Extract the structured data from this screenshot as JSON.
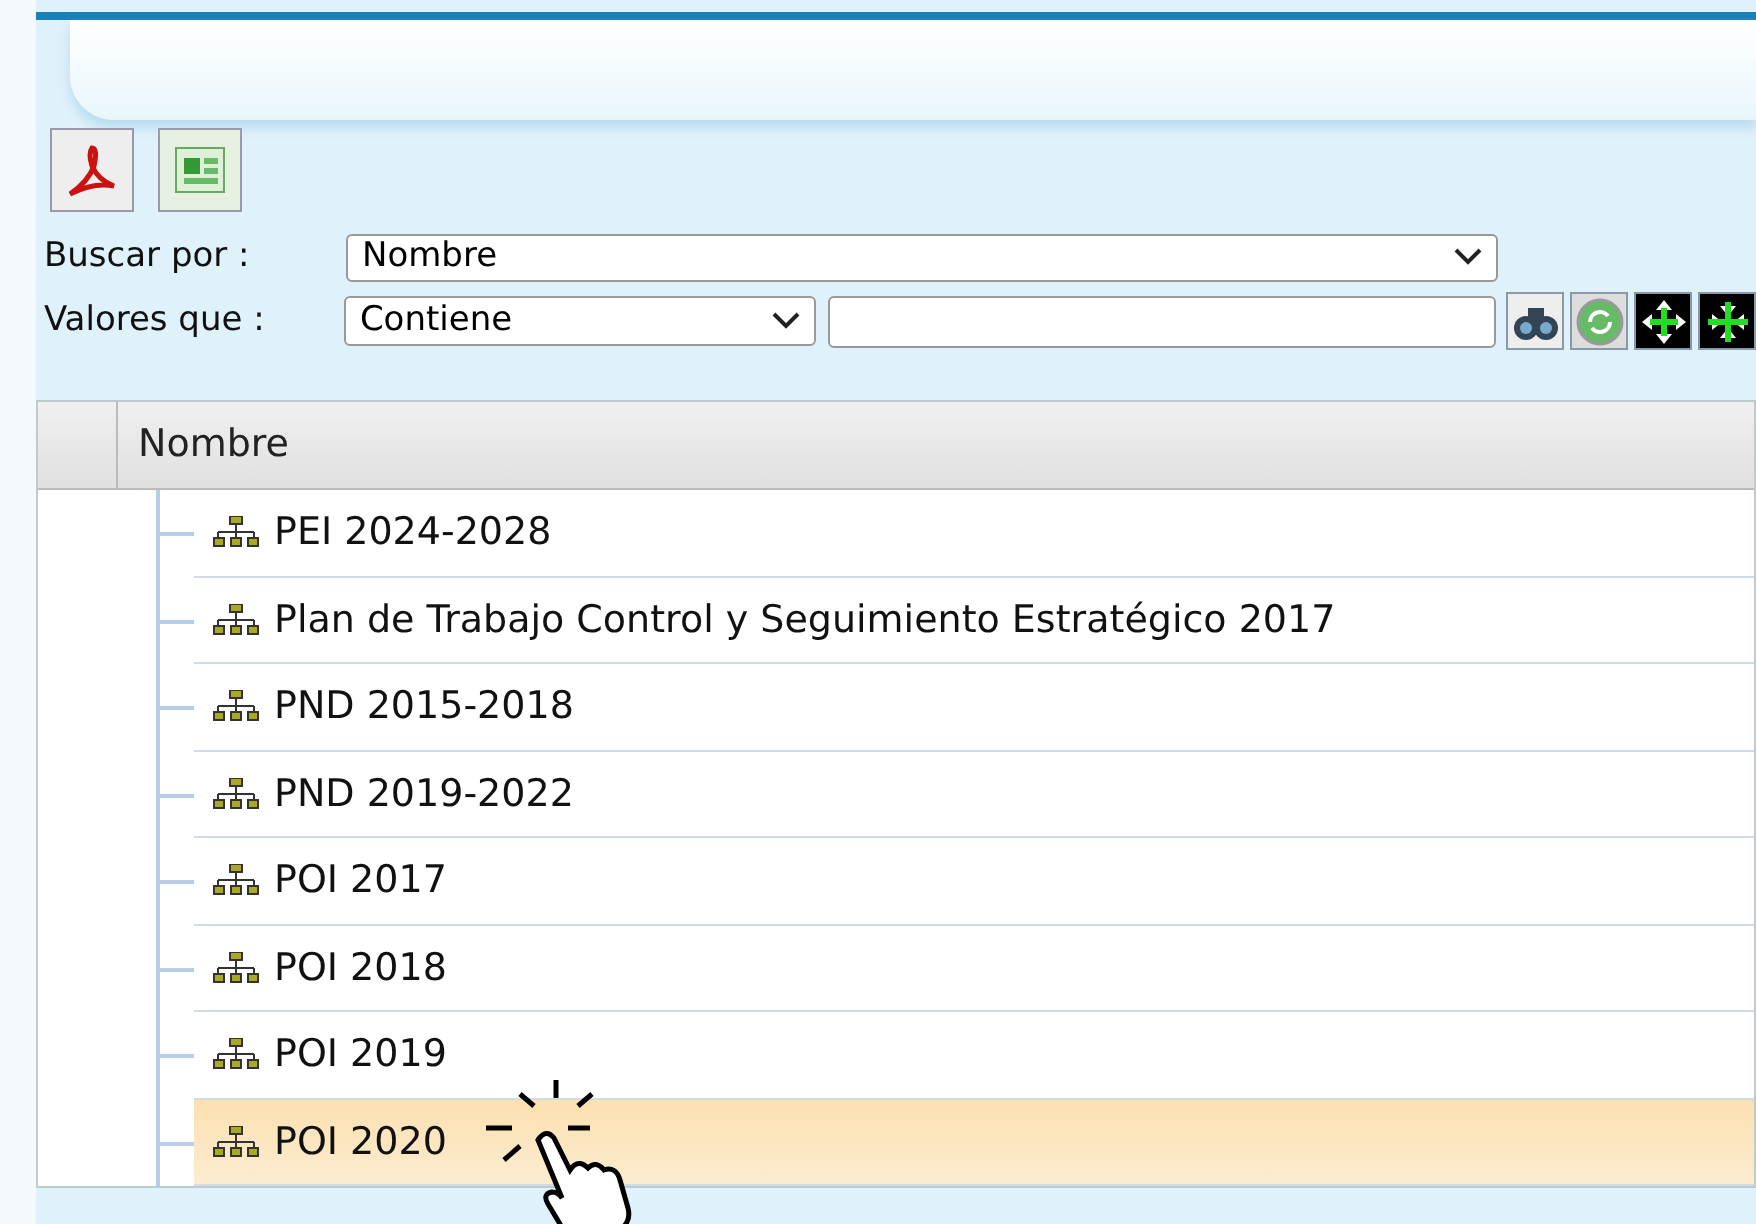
{
  "toolbar": {
    "buttons": [
      {
        "kind": "pdf"
      },
      {
        "kind": "excel"
      }
    ]
  },
  "search": {
    "by_label": "Buscar por :",
    "by_value": "Nombre",
    "values_label": "Valores que :",
    "values_value": "Contiene"
  },
  "action_buttons": [
    {
      "kind": "search"
    },
    {
      "kind": "refresh"
    },
    {
      "kind": "expand"
    },
    {
      "kind": "collapse"
    }
  ],
  "table": {
    "columns": [
      "Nombre"
    ],
    "rows": [
      {
        "name": "PEI 2024-2028",
        "selected": false
      },
      {
        "name": "Plan de Trabajo Control y Seguimiento Estratégico 2017",
        "selected": false
      },
      {
        "name": "PND 2015-2018",
        "selected": false
      },
      {
        "name": "PND 2019-2022",
        "selected": false
      },
      {
        "name": "POI 2017",
        "selected": false
      },
      {
        "name": "POI 2018",
        "selected": false
      },
      {
        "name": "POI 2019",
        "selected": false
      },
      {
        "name": "POI 2020",
        "selected": true
      }
    ]
  }
}
